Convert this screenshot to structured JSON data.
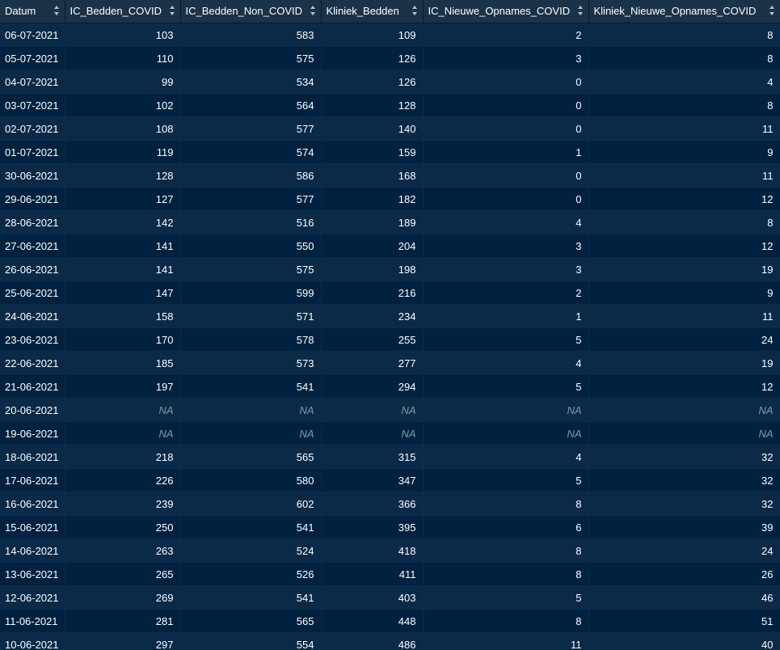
{
  "columns": [
    {
      "key": "datum",
      "label": "Datum"
    },
    {
      "key": "ic_covid",
      "label": "IC_Bedden_COVID"
    },
    {
      "key": "ic_non_covid",
      "label": "IC_Bedden_Non_COVID"
    },
    {
      "key": "kliniek",
      "label": "Kliniek_Bedden"
    },
    {
      "key": "ic_opnames",
      "label": "IC_Nieuwe_Opnames_COVID"
    },
    {
      "key": "kliniek_opnames",
      "label": "Kliniek_Nieuwe_Opnames_COVID"
    }
  ],
  "rows": [
    [
      "06-07-2021",
      "103",
      "583",
      "109",
      "2",
      "8"
    ],
    [
      "05-07-2021",
      "110",
      "575",
      "126",
      "3",
      "8"
    ],
    [
      "04-07-2021",
      "99",
      "534",
      "126",
      "0",
      "4"
    ],
    [
      "03-07-2021",
      "102",
      "564",
      "128",
      "0",
      "8"
    ],
    [
      "02-07-2021",
      "108",
      "577",
      "140",
      "0",
      "11"
    ],
    [
      "01-07-2021",
      "119",
      "574",
      "159",
      "1",
      "9"
    ],
    [
      "30-06-2021",
      "128",
      "586",
      "168",
      "0",
      "11"
    ],
    [
      "29-06-2021",
      "127",
      "577",
      "182",
      "0",
      "12"
    ],
    [
      "28-06-2021",
      "142",
      "516",
      "189",
      "4",
      "8"
    ],
    [
      "27-06-2021",
      "141",
      "550",
      "204",
      "3",
      "12"
    ],
    [
      "26-06-2021",
      "141",
      "575",
      "198",
      "3",
      "19"
    ],
    [
      "25-06-2021",
      "147",
      "599",
      "216",
      "2",
      "9"
    ],
    [
      "24-06-2021",
      "158",
      "571",
      "234",
      "1",
      "11"
    ],
    [
      "23-06-2021",
      "170",
      "578",
      "255",
      "5",
      "24"
    ],
    [
      "22-06-2021",
      "185",
      "573",
      "277",
      "4",
      "19"
    ],
    [
      "21-06-2021",
      "197",
      "541",
      "294",
      "5",
      "12"
    ],
    [
      "20-06-2021",
      "NA",
      "NA",
      "NA",
      "NA",
      "NA"
    ],
    [
      "19-06-2021",
      "NA",
      "NA",
      "NA",
      "NA",
      "NA"
    ],
    [
      "18-06-2021",
      "218",
      "565",
      "315",
      "4",
      "32"
    ],
    [
      "17-06-2021",
      "226",
      "580",
      "347",
      "5",
      "32"
    ],
    [
      "16-06-2021",
      "239",
      "602",
      "366",
      "8",
      "32"
    ],
    [
      "15-06-2021",
      "250",
      "541",
      "395",
      "6",
      "39"
    ],
    [
      "14-06-2021",
      "263",
      "524",
      "418",
      "8",
      "24"
    ],
    [
      "13-06-2021",
      "265",
      "526",
      "411",
      "8",
      "26"
    ],
    [
      "12-06-2021",
      "269",
      "541",
      "403",
      "5",
      "46"
    ],
    [
      "11-06-2021",
      "281",
      "565",
      "448",
      "8",
      "51"
    ],
    [
      "10-06-2021",
      "297",
      "554",
      "486",
      "11",
      "40"
    ]
  ],
  "na_marker": "NA",
  "icons": {
    "sort": "sort-arrows-icon"
  },
  "colors": {
    "background": "#002240",
    "row_alt": "#0a2a48",
    "header": "#1b3349",
    "text": "#ffffff",
    "na_text": "#8797a6"
  }
}
